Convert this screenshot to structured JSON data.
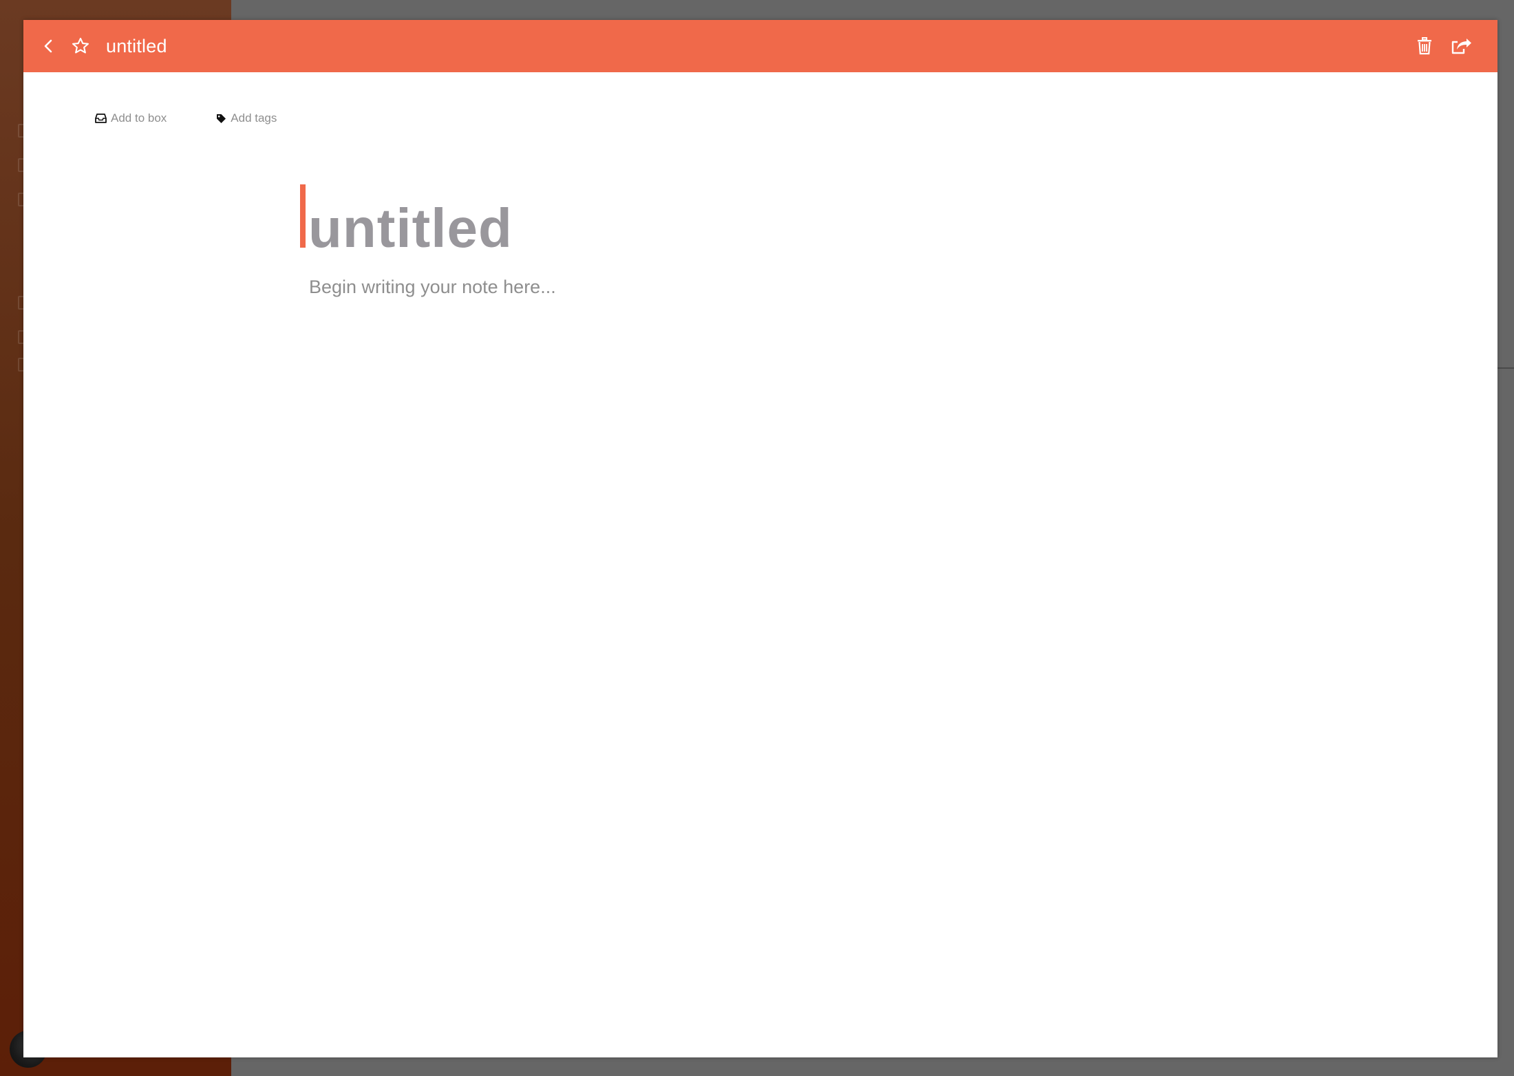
{
  "header": {
    "title": "untitled",
    "back_icon": "chevron-left-icon",
    "star_icon": "star-outline-icon",
    "trash_icon": "trash-icon",
    "share_icon": "share-icon",
    "accent_color": "#f0694a"
  },
  "meta": {
    "box_label": "Add to box",
    "box_icon": "inbox-icon",
    "tags_label": "Add tags",
    "tags_icon": "tag-icon"
  },
  "note": {
    "title_placeholder": "untitled",
    "body_placeholder": "Begin writing your note here..."
  }
}
